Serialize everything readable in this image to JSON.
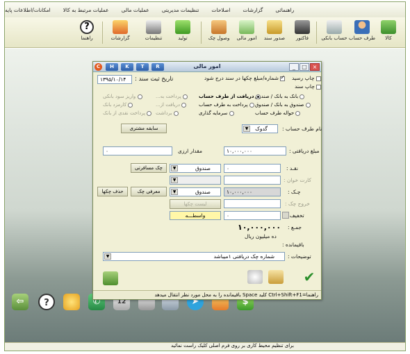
{
  "menu": [
    "امکانات/اطلاعات پایه",
    "عملیات مرتبط به کالا",
    "عملیات مالی",
    "تنظیمات مدیریتی",
    "اصلاحات",
    "گزارشات",
    "راهنمائی"
  ],
  "toolbar": [
    "کالا",
    "طرف حساب",
    "حساب بانکی",
    "فاکتور",
    "صدور سند",
    "امور مالی",
    "وصول چک",
    "تولید",
    "تنظیمات",
    "گزارشات",
    "راهنما"
  ],
  "dialog": {
    "title": "امور مالی",
    "keys": [
      "H",
      "K",
      "T",
      "R"
    ],
    "app_icon": "C",
    "date_label": "تاریخ ثبت سند :",
    "date_value": "۱۳۹۵/۱۰/۱۴",
    "print_receipt": "چاپ رسید",
    "print_doc": "چاپ سند",
    "include_check_numbers": "شماره/مبلغ چکها در سند درج شود",
    "radio_col1": [
      "بانک به بانک / صندوق",
      "صندوق به بانک / صندوق",
      "حواله طرف حساب"
    ],
    "radio_col2": [
      "دریافت از طرف حساب",
      "پرداخت به طرف حساب",
      "سرمایه گذاری"
    ],
    "radio_col3": [
      "پرداخت به...",
      "دریافت از...",
      "برداشت"
    ],
    "radio_col4": [
      "واریز سود بانکی",
      "کارمزد بانک",
      "پرداخت نقدی از بانک"
    ],
    "account_label": "نام طرف حساب :",
    "account_value": "گدوک",
    "customer_history": "سابقه مشتری",
    "received_amount_label": "مبلغ دریافتی :",
    "received_amount": "۱۰,۰۰۰,۰۰۰",
    "fx_amount_label": "مقدار ارزی",
    "fx_amount": "۰",
    "cash_label": "نقـد :",
    "cash_value": "۰",
    "cash_source": "صندوق",
    "traveler_check": "چک مسافرتی",
    "card_reader_label": "کارت خوان :",
    "check_label": "چـک :",
    "check_value": "۱۰,۰۰۰,۰۰۰",
    "check_source": "صندوق",
    "check_intro": "معرفی چک",
    "delete_checks": "حذف چکها",
    "check_out_label": "خروج چک :",
    "check_list": "لیست چکها",
    "discount_label": "تخفیف :",
    "discount_value": "۰",
    "intermediary": "واسطـــه",
    "total_label": "جمـع :",
    "total_value": "۱۰,۰۰۰,۰۰۰",
    "total_words": "ده میلیون ریال",
    "remaining_label": "باقیمانده :",
    "remaining_value": "",
    "notes_label": "توضیحات :",
    "notes_value": "شماره چک دریافتی ۱میباشد",
    "status": "راهنما=Ctrl+Shift+F1   کلید Space باقیمانده را به محل مورد نظر انتقال میدهد"
  },
  "statusbar": "برای تنظیم محیط کاری بر روی فرم اصلی کلیک راست نمائید"
}
